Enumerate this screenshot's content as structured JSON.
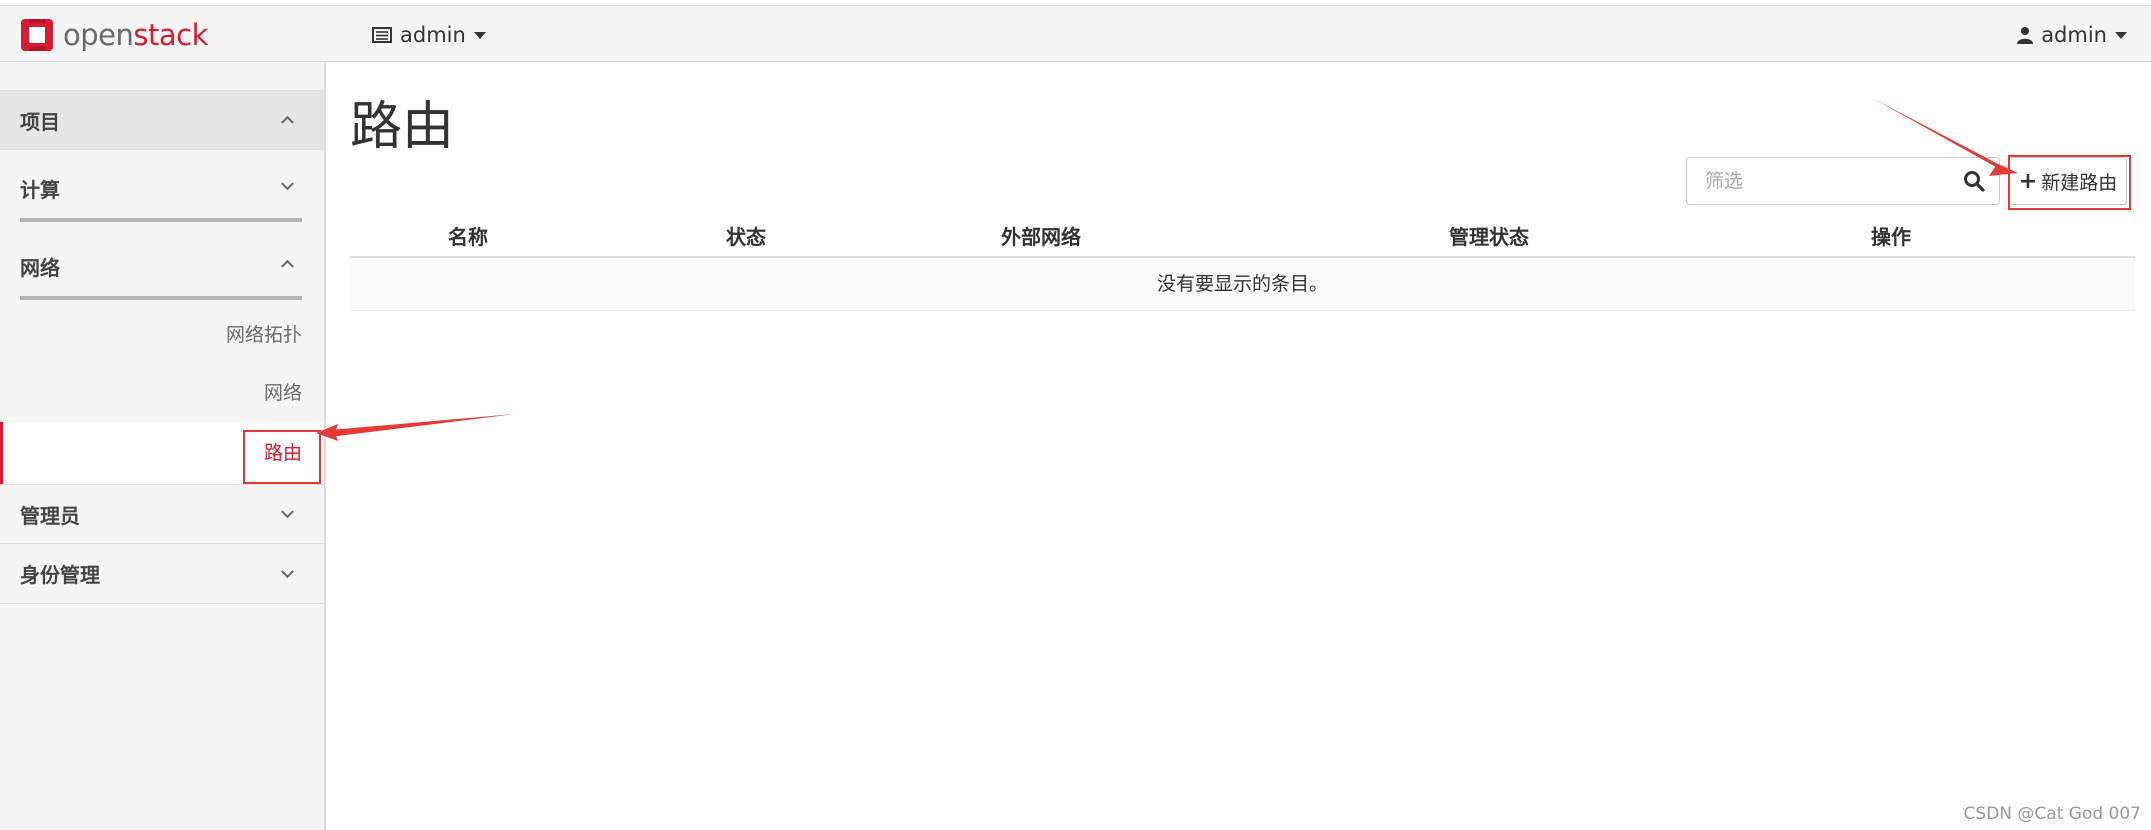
{
  "brand": {
    "part1": "open",
    "part2": "stack",
    "logo_color": "#da1a32"
  },
  "header": {
    "project_menu": "admin",
    "user_menu": "admin"
  },
  "sidebar": {
    "project_label": "项目",
    "compute_label": "计算",
    "network_label": "网络",
    "network_items": [
      "网络拓扑",
      "网络",
      "路由"
    ],
    "active_item": "路由",
    "admin_label": "管理员",
    "identity_label": "身份管理"
  },
  "page": {
    "title": "路由",
    "filter_placeholder": "筛选",
    "create_button": "新建路由"
  },
  "table": {
    "columns": [
      "名称",
      "状态",
      "外部网络",
      "管理状态",
      "操作"
    ],
    "empty_message": "没有要显示的条目。"
  },
  "watermark": "CSDN @Cat God 007",
  "colors": {
    "accent": "#da1a32",
    "annotation": "#e53935"
  }
}
